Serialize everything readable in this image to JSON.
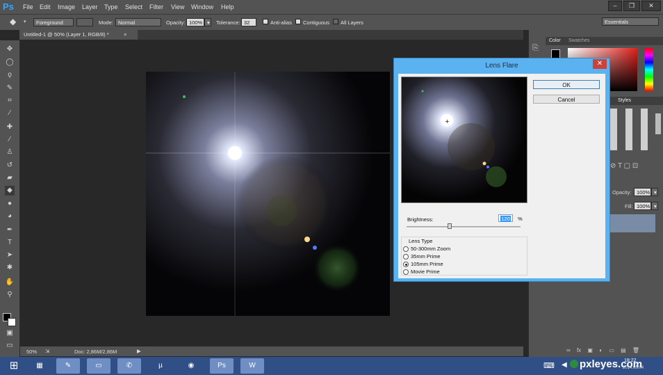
{
  "app": {
    "logo": "Ps"
  },
  "menu": [
    "File",
    "Edit",
    "Image",
    "Layer",
    "Type",
    "Select",
    "Filter",
    "View",
    "Window",
    "Help"
  ],
  "window_controls": [
    "–",
    "❐",
    "✕"
  ],
  "options": {
    "preset": "Foreground",
    "mode_label": "Mode:",
    "mode_value": "Normal",
    "opacity_label": "Opacity:",
    "opacity_value": "100%",
    "tolerance_label": "Tolerance:",
    "tolerance_value": "32",
    "anti_alias": "Anti-alias",
    "contiguous": "Contiguous",
    "all_layers": "All Layers",
    "workspace": "Essentials"
  },
  "document": {
    "tab_title": "Untitled-1 @ 50% (Layer 1, RGB/8) *",
    "tab_close": "×"
  },
  "status": {
    "zoom": "50%",
    "doc": "Doc: 2,86M/2,86M"
  },
  "panels": {
    "color_tabs": [
      "Color",
      "Swatches"
    ],
    "styles_tab": "Styles",
    "opacity_label": "Opacity:",
    "opacity_value": "100%",
    "fill_label": "Fill:",
    "fill_value": "100%",
    "layers_bottom_icons": [
      "∞",
      "fx",
      "▣",
      "◐",
      "▭",
      "▤",
      "🗑"
    ]
  },
  "dialog": {
    "title": "Lens Flare",
    "close": "✕",
    "ok": "OK",
    "cancel": "Cancel",
    "brightness_label": "Brightness:",
    "brightness_value": "120",
    "brightness_unit": "%",
    "brightness_fraction": 0.38,
    "lens_type_label": "Lens Type",
    "lens_types": [
      "50-300mm Zoom",
      "35mm Prime",
      "105mm Prime",
      "Movie Prime"
    ],
    "selected_lens": 2
  },
  "taskbar": {
    "clock": "18:22",
    "date": "2014.05.04",
    "watermark": "pxleyes.com"
  }
}
